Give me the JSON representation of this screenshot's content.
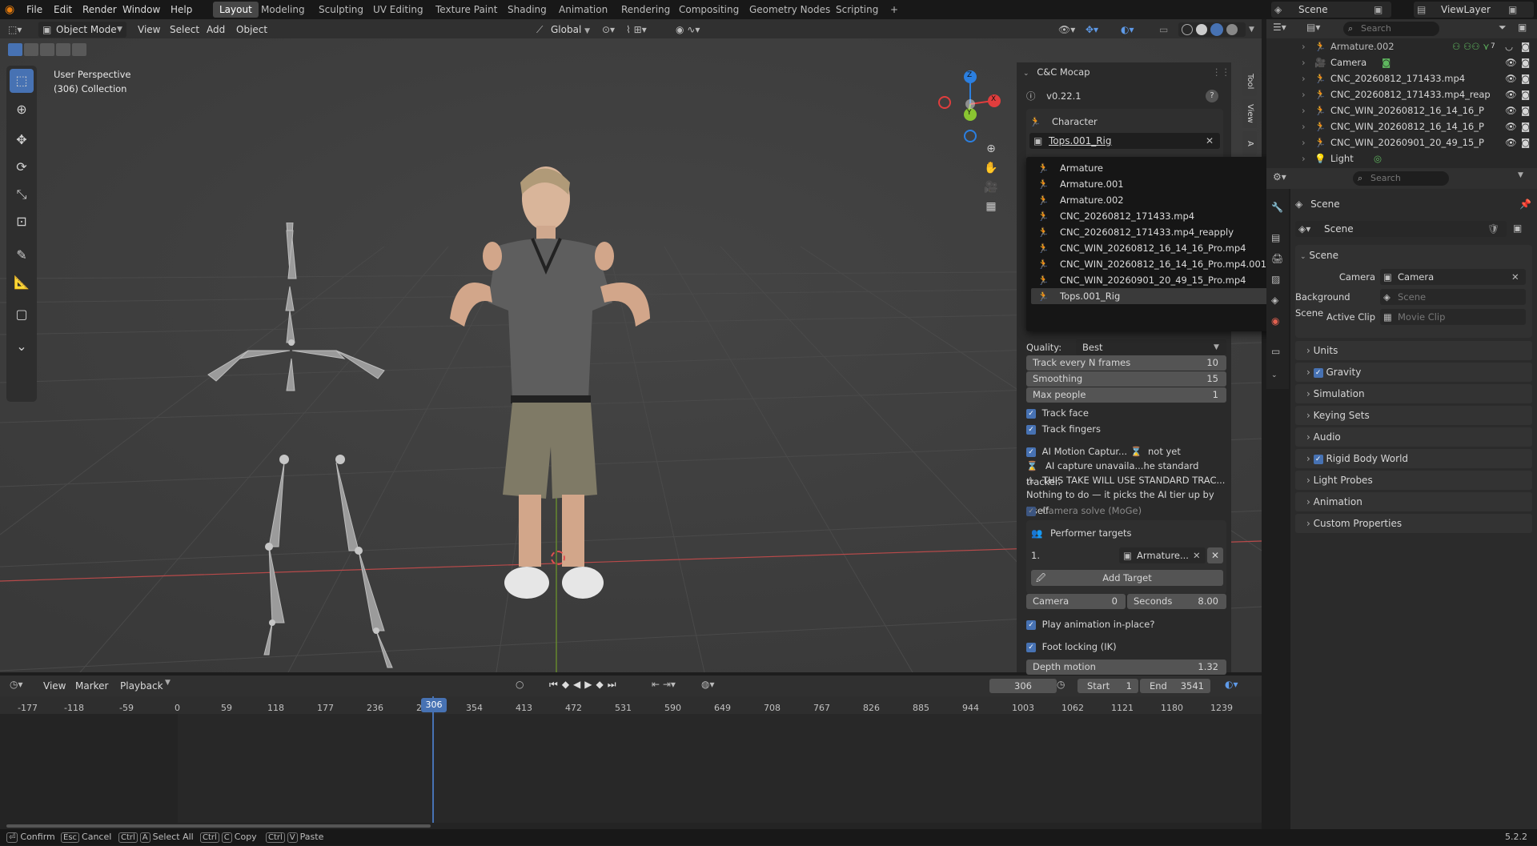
{
  "menu": [
    "File",
    "Edit",
    "Render",
    "Window",
    "Help"
  ],
  "workspaces": [
    "Layout",
    "Modeling",
    "Sculpting",
    "UV Editing",
    "Texture Paint",
    "Shading",
    "Animation",
    "Rendering",
    "Compositing",
    "Geometry Nodes",
    "Scripting"
  ],
  "active_workspace": "Layout",
  "scene": {
    "label": "Scene",
    "viewlayer": "ViewLayer"
  },
  "viewport_header": {
    "mode": "Object Mode",
    "items": [
      "View",
      "Select",
      "Add",
      "Object"
    ],
    "transform": "Global",
    "options": "Options"
  },
  "overlay_text": {
    "perspective": "User Perspective",
    "collection": "(306) Collection"
  },
  "gizmo": {
    "x": "X",
    "y": "Y",
    "z": "Z"
  },
  "npanel": {
    "title": "C&C Mocap",
    "version": "v0.22.1",
    "character_label": "Character",
    "character_value": "Tops.001_Rig",
    "quality_label": "Quality:",
    "quality_value": "Best",
    "track_every_label": "Track every N frames",
    "track_every_value": "10",
    "smoothing_label": "Smoothing",
    "smoothing_value": "15",
    "max_people_label": "Max people",
    "max_people_value": "1",
    "track_face": "Track face",
    "track_fingers": "Track fingers",
    "ai_capture": "AI Motion Captur...",
    "ai_status": "not yet",
    "ai_unavail": "AI capture unavaila...he standard tracker.",
    "warning": "THIS TAKE WILL USE STANDARD TRAC...",
    "nothing": "Nothing to do — it picks the AI tier up by itself",
    "camera_solve": "Camera solve (MoGe)",
    "performer_targets": "Performer targets",
    "target_index": "1.",
    "target_value": "Armature...",
    "add_target": "Add Target",
    "camera_label": "Camera",
    "camera_value": "0",
    "seconds_label": "Seconds",
    "seconds_value": "8.00",
    "play_inplace": "Play animation in-place?",
    "foot_locking": "Foot locking (IK)",
    "depth_label": "Depth motion",
    "depth_value": "1.32",
    "tabs": [
      "Tool",
      "View",
      "A"
    ]
  },
  "dropdown_items": [
    "Armature",
    "Armature.001",
    "Armature.002",
    "CNC_20260812_171433.mp4",
    "CNC_20260812_171433.mp4_reapply",
    "CNC_WIN_20260812_16_14_16_Pro.mp4",
    "CNC_WIN_20260812_16_14_16_Pro.mp4.001",
    "CNC_WIN_20260901_20_49_15_Pro.mp4",
    "Tops.001_Rig"
  ],
  "outliner": {
    "search_placeholder": "Search",
    "rows": [
      "Armature.002",
      "Camera",
      "CNC_20260812_171433.mp4",
      "CNC_20260812_171433.mp4_reap",
      "CNC_WIN_20260812_16_14_16_P",
      "CNC_WIN_20260812_16_14_16_P",
      "CNC_WIN_20260901_20_49_15_P",
      "Light"
    ],
    "badge": "7"
  },
  "properties": {
    "search_placeholder": "Search",
    "header": "Scene",
    "datablock": "Scene",
    "section_scene": "Scene",
    "camera_label": "Camera",
    "camera_value": "Camera",
    "bg_label": "Background Scene",
    "bg_value": "Scene",
    "clip_label": "Active Clip",
    "clip_value": "Movie Clip",
    "sections": [
      "Units",
      "Gravity",
      "Simulation",
      "Keying Sets",
      "Audio",
      "Rigid Body World",
      "Light Probes",
      "Animation",
      "Custom Properties"
    ]
  },
  "timeline": {
    "menus": [
      "View",
      "Marker",
      "Playback"
    ],
    "current_frame": "306",
    "start_label": "Start",
    "start": "1",
    "end_label": "End",
    "end": "3541",
    "ticks": [
      "-177",
      "-118",
      "-59",
      "0",
      "59",
      "118",
      "177",
      "236",
      "2",
      "306",
      "354",
      "413",
      "472",
      "531",
      "590",
      "649",
      "708",
      "767",
      "826",
      "885",
      "944",
      "1003",
      "1062",
      "1121",
      "1180",
      "1239"
    ]
  },
  "status": [
    {
      "key": "⏎",
      "label": "Confirm"
    },
    {
      "key": "Esc",
      "label": "Cancel"
    },
    {
      "key": "Ctrl",
      "key2": "A",
      "label": "Select All"
    },
    {
      "key": "Ctrl",
      "key2": "C",
      "label": "Copy"
    },
    {
      "key": "Ctrl",
      "key2": "V",
      "label": "Paste"
    }
  ],
  "version": "5.2.2",
  "colors": {
    "accent": "#4772b3",
    "x_axis": "#e03d3d",
    "y_axis": "#8ac531",
    "z_axis": "#2b7fe0"
  }
}
